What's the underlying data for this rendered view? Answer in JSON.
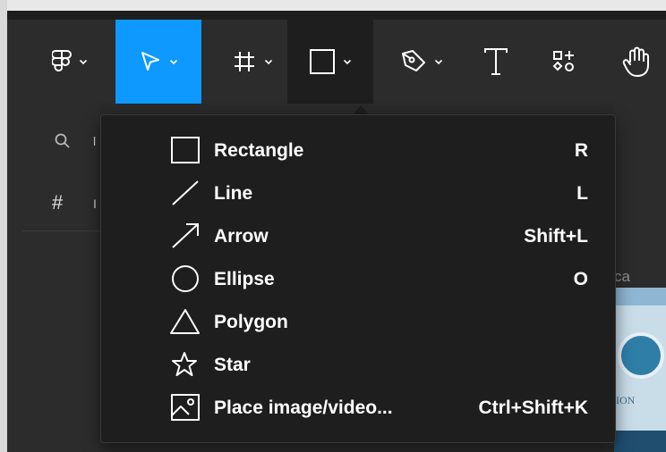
{
  "toolbar": {
    "tools": [
      {
        "name": "main-menu",
        "icon": "figma-logo-icon",
        "has_dropdown": true
      },
      {
        "name": "move",
        "icon": "cursor-arrow-icon",
        "has_dropdown": true,
        "active": true
      },
      {
        "name": "frame",
        "icon": "hash-frame-icon",
        "has_dropdown": true
      },
      {
        "name": "shape",
        "icon": "square-icon",
        "has_dropdown": true,
        "menu_open": true
      },
      {
        "name": "pen",
        "icon": "pen-nib-icon",
        "has_dropdown": true
      },
      {
        "name": "text",
        "icon": "text-t-icon"
      },
      {
        "name": "resources",
        "icon": "resources-grid-icon"
      },
      {
        "name": "hand",
        "icon": "hand-icon"
      }
    ],
    "active_color": "#0d99ff"
  },
  "shape_menu": {
    "items": [
      {
        "label": "Rectangle",
        "shortcut": "R",
        "icon": "rectangle-icon"
      },
      {
        "label": "Line",
        "shortcut": "L",
        "icon": "line-icon"
      },
      {
        "label": "Arrow",
        "shortcut": "Shift+L",
        "icon": "arrow-icon"
      },
      {
        "label": "Ellipse",
        "shortcut": "O",
        "icon": "ellipse-icon"
      },
      {
        "label": "Polygon",
        "shortcut": "",
        "icon": "polygon-icon"
      },
      {
        "label": "Star",
        "shortcut": "",
        "icon": "star-icon"
      },
      {
        "label": "Place image/video...",
        "shortcut": "Ctrl+Shift+K",
        "icon": "image-icon"
      }
    ]
  },
  "left_panel": {
    "search_icon": "search-icon",
    "search_text": "l",
    "frames_icon": "hash-icon",
    "frames_text": "I"
  },
  "canvas": {
    "label_fragment": "ca",
    "card_text_fragment": "ION"
  }
}
